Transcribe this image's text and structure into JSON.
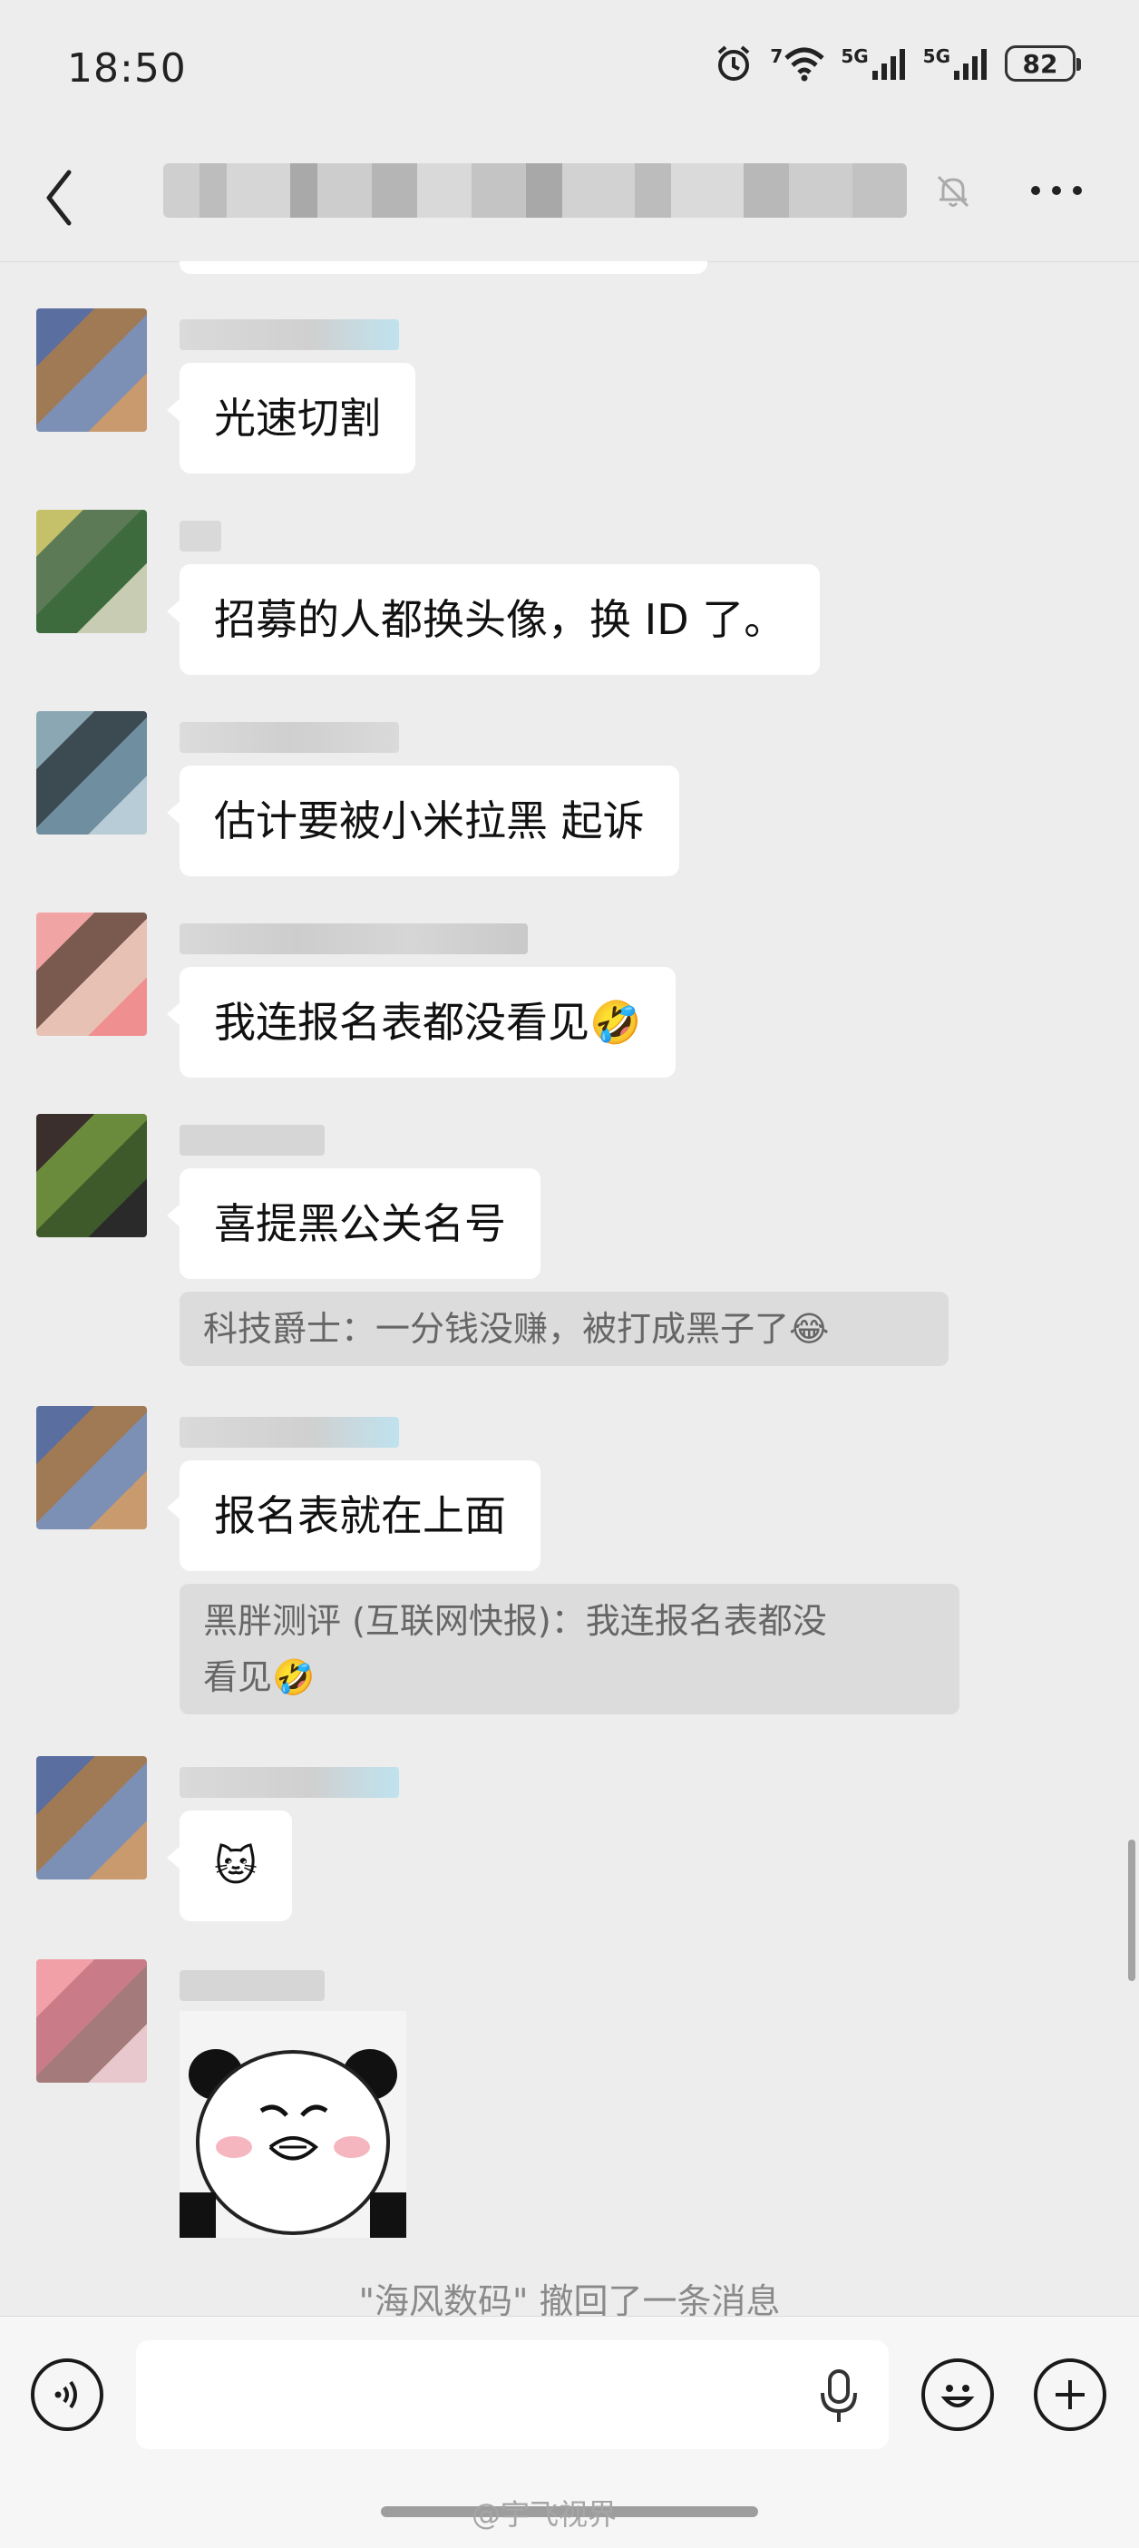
{
  "status_bar": {
    "time": "18:50",
    "network_1_label": "7",
    "network_2_label": "5G",
    "network_3_label": "5G",
    "battery": "82",
    "icons": [
      "alarm-icon",
      "wifi-icon",
      "signal-icon",
      "signal-icon",
      "battery-icon"
    ]
  },
  "nav": {
    "back_icon": "chevron-left-icon",
    "mute_icon": "bell-off-icon",
    "more_icon": "more-dots-icon"
  },
  "messages": [
    {
      "text": "光速切割"
    },
    {
      "text": "招募的人都换头像，换 ID 了。"
    },
    {
      "text": "估计要被小米拉黑 起诉"
    },
    {
      "text": "我连报名表都没看见",
      "emoji": "🤣"
    },
    {
      "text": "喜提黑公关名号",
      "quote": "科技爵士：一分钱没赚，被打成黑子了",
      "quote_emoji": "😂"
    },
    {
      "text": "报名表就在上面",
      "quote_line1": "黑胖测评 (互联网快报)：我连报名表都没",
      "quote_line2": "看见",
      "quote_emoji": "🤣"
    },
    {
      "emoji": "🐱"
    },
    {
      "sticker": "panda-meme-sticker"
    }
  ],
  "system_message": "\"海风数码\" 撤回了一条消息",
  "input_bar": {
    "voice_icon": "voice-icon",
    "emoji_icon": "smiley-icon",
    "plus_icon": "plus-icon",
    "mic_icon": "mic-icon",
    "input_value": ""
  },
  "watermark": "@宇飞视界",
  "colors": {
    "background": "#ededed",
    "bubble": "#ffffff",
    "quote": "#dcdcdc",
    "system_text": "#8a8a8a"
  }
}
